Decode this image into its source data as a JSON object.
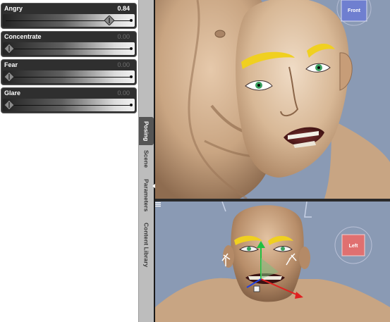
{
  "parameters": [
    {
      "label": "Angry",
      "value": "0.84",
      "active": true,
      "level": 0.84
    },
    {
      "label": "Concentrate",
      "value": "0.00",
      "active": false,
      "level": 0.0
    },
    {
      "label": "Fear",
      "value": "0.00",
      "active": false,
      "level": 0.0
    },
    {
      "label": "Glare",
      "value": "0.00",
      "active": false,
      "level": 0.0
    }
  ],
  "tabs": [
    "Posing",
    "Scene",
    "Parameters",
    "Content Library"
  ],
  "active_tab": "Posing",
  "viewports": {
    "top": {
      "camera_cube_label": "Front"
    },
    "bottom": {
      "camera_cube_label": "Left"
    }
  },
  "colors": {
    "viewport_bg": "#8a9ab4",
    "slider_item_bg": "#2f2f2f",
    "eyebrow_highlight": "#f0d020",
    "camera_cube_front": "#6f7fd0",
    "camera_cube_left": "#e07070"
  }
}
